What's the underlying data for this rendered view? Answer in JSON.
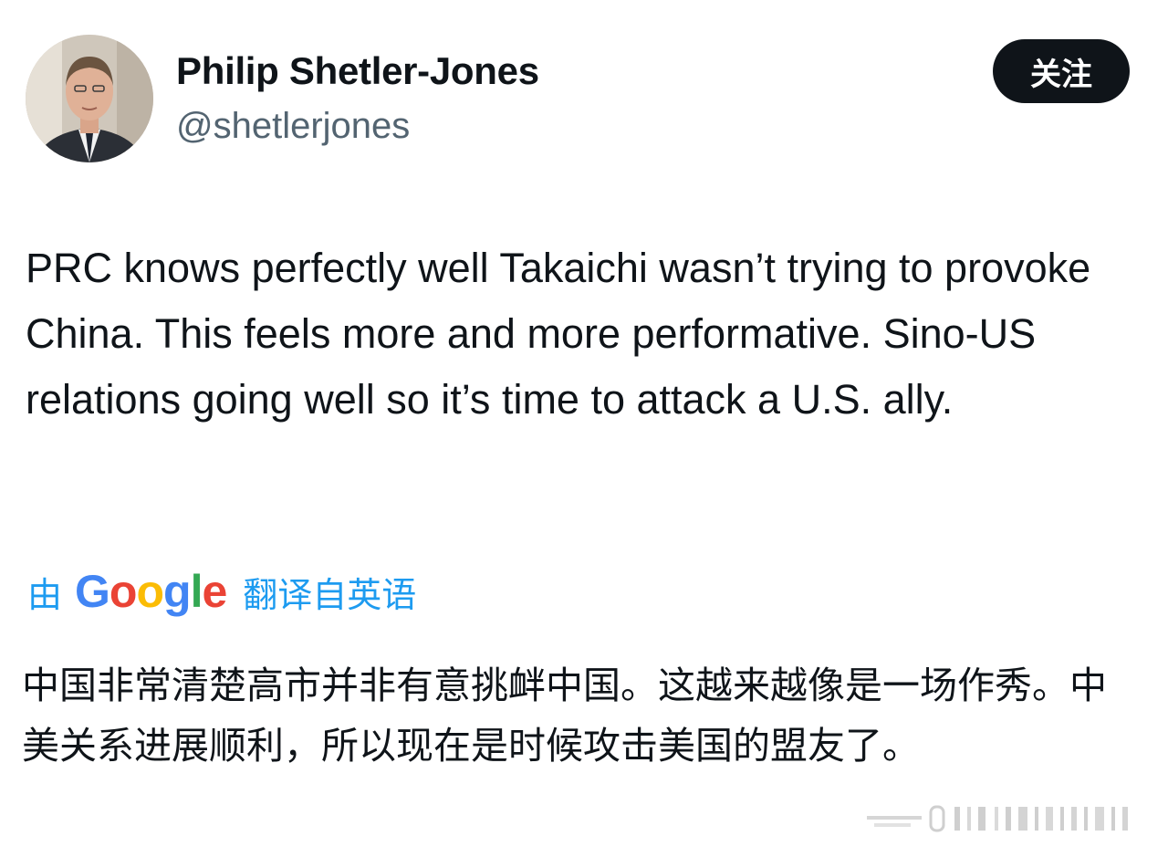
{
  "author": {
    "display_name": "Philip Shetler-Jones",
    "handle": "@shetlerjones",
    "avatar_icon": "user-avatar-photo"
  },
  "follow_button": {
    "label": "关注",
    "bg_color": "#0f1419",
    "text_color": "#ffffff"
  },
  "tweet": {
    "text": "PRC knows perfectly well Takaichi wasn’t trying to provoke China. This feels more and more performative. Sino-US relations going well so it’s time to attack a U.S. ally."
  },
  "translation": {
    "prefix": "由",
    "provider_letters": [
      "G",
      "o",
      "o",
      "g",
      "l",
      "e"
    ],
    "suffix": "翻译自英语",
    "link_color": "#1d9bf0",
    "translated_text": "中国非常清楚高市并非有意挑衅中国。这越来越像是一场作秀。中美关系进展顺利，所以现在是时候攻击美国的盟友了。"
  },
  "watermark": {
    "icon": "watermark-barcode-icon"
  }
}
